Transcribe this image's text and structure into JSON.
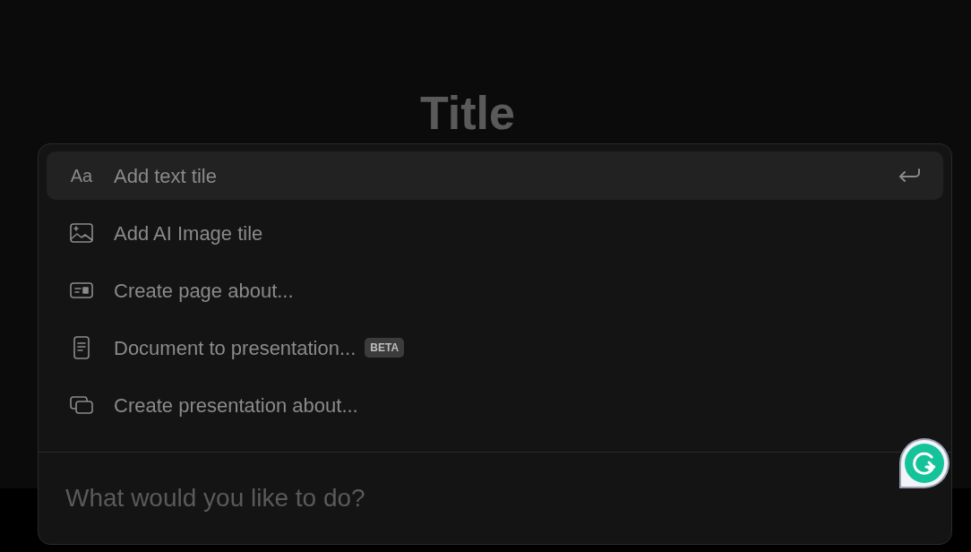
{
  "page": {
    "title": "Title"
  },
  "menu": {
    "items": [
      {
        "kind": "text",
        "label": "Add text tile",
        "icon_text": "Aa",
        "selected": true
      },
      {
        "kind": "image",
        "label": "Add AI Image tile",
        "selected": false
      },
      {
        "kind": "page",
        "label": "Create page about...",
        "selected": false
      },
      {
        "kind": "document",
        "label": "Document to presentation...",
        "badge": "BETA",
        "selected": false
      },
      {
        "kind": "presentation",
        "label": "Create presentation about...",
        "selected": false
      }
    ]
  },
  "prompt": {
    "placeholder": "What would you like to do?"
  }
}
